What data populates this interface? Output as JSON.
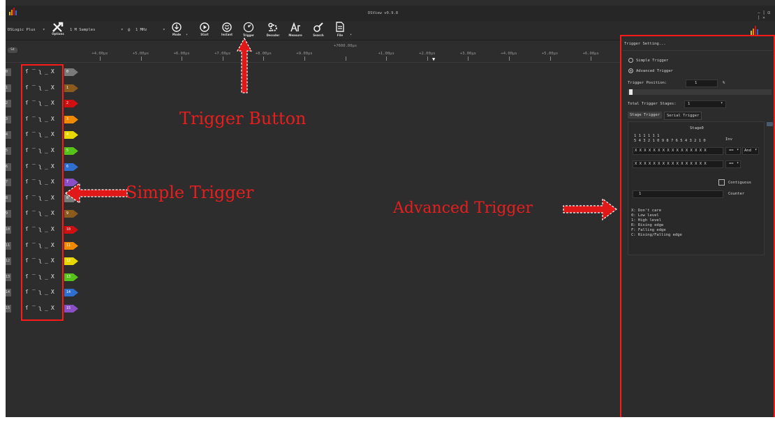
{
  "window": {
    "title": "DSView v0.9.8",
    "controls": "– | ⊡ | ✕"
  },
  "toolbar": {
    "device": "DSLogic Plus",
    "samples": "1 M Samples",
    "rate_prefix": "@",
    "rate": "1 MHz",
    "buttons": [
      {
        "label": "Options",
        "icon": "wrench-icon"
      },
      {
        "label": "Mode",
        "icon": "mode-icon"
      },
      {
        "label": "Start",
        "icon": "start-icon"
      },
      {
        "label": "Instant",
        "icon": "instant-icon"
      },
      {
        "label": "Trigger",
        "icon": "trigger-icon"
      },
      {
        "label": "Decoder",
        "icon": "decoder-icon"
      },
      {
        "label": "Measure",
        "icon": "measure-icon"
      },
      {
        "label": "Search",
        "icon": "search-icon"
      },
      {
        "label": "File",
        "icon": "file-icon"
      }
    ]
  },
  "ruler": {
    "corner": "S4",
    "ticks": [
      "+4.00μs",
      "+5.00μs",
      "+6.00μs",
      "+7.00μs",
      "+8.00μs",
      "+9.00μs",
      "+7600.00μs",
      "+1.00μs",
      "+2.00μs",
      "+3.00μs",
      "+4.00μs",
      "+5.00μs",
      "+6.00μs",
      "+7.0"
    ]
  },
  "channels": {
    "trigger_glyphs": "ſ‾ʅ_X",
    "items": [
      {
        "num": "0",
        "color": "#7a7a7a"
      },
      {
        "num": "1",
        "color": "#8b5a1e"
      },
      {
        "num": "2",
        "color": "#d01010"
      },
      {
        "num": "3",
        "color": "#f08a00"
      },
      {
        "num": "4",
        "color": "#e8d800"
      },
      {
        "num": "5",
        "color": "#56c21a"
      },
      {
        "num": "6",
        "color": "#2f6fd0"
      },
      {
        "num": "7",
        "color": "#8a4fc4"
      },
      {
        "num": "8",
        "color": "#7a7a7a"
      },
      {
        "num": "9",
        "color": "#8b5a1e"
      },
      {
        "num": "10",
        "color": "#d01010"
      },
      {
        "num": "11",
        "color": "#f08a00"
      },
      {
        "num": "12",
        "color": "#e8d800"
      },
      {
        "num": "13",
        "color": "#56c21a"
      },
      {
        "num": "14",
        "color": "#2f6fd0"
      },
      {
        "num": "15",
        "color": "#8a4fc4"
      }
    ]
  },
  "annotations": {
    "trigger_button": "Trigger Button",
    "simple_trigger": "Simple Trigger",
    "advanced_trigger": "Advanced Trigger",
    "color": "#e81e1e"
  },
  "panel": {
    "title": "Trigger Setting...",
    "simple_trigger": "Simple Trigger",
    "advanced_trigger": "Advanced Trigger",
    "trigger_position_label": "Trigger Position:",
    "trigger_position_value": "1",
    "trigger_position_unit": "%",
    "trigger_position_fraction": 0.01,
    "total_stages_label": "Total Trigger Stages:",
    "total_stages_value": "1",
    "tab_stage": "Stage Trigger",
    "tab_serial": "Serial Trigger",
    "stage_title": "Stage0",
    "bits_row1": "1 1 1 1 1 1",
    "bits_row2": "5 4 3 2 1 0 9 8 7 6 5 4 3 2 1 0",
    "inv_label": "Inv",
    "mask_row1": "X X X X X X X X X X X X X X X X",
    "mask_row2": "X X X X X X X X X X X X X X X X",
    "op1": "==",
    "logic": "And",
    "op2": "==",
    "contiguous_label": "Contiguous",
    "counter_value": "1",
    "counter_label": "Counter",
    "legend": [
      "X: Don't care",
      "0: Low level",
      "1: High level",
      "R: Rising edge",
      "F: Falling edge",
      "C: Rising/Falling edge"
    ]
  }
}
